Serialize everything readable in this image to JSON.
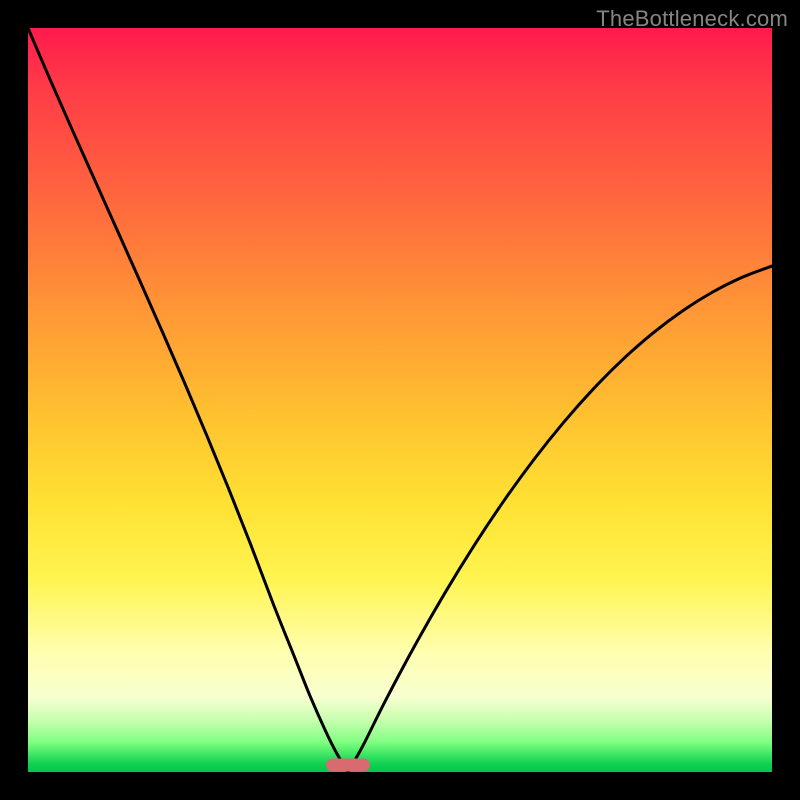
{
  "watermark": "TheBottleneck.com",
  "chart_data": {
    "type": "line",
    "title": "",
    "xlabel": "",
    "ylabel": "",
    "xlim": [
      0,
      100
    ],
    "ylim": [
      0,
      100
    ],
    "gradient_stops": [
      {
        "t": 0,
        "color": "#ff1a4d"
      },
      {
        "t": 8,
        "color": "#ff3b47"
      },
      {
        "t": 24,
        "color": "#ff6a3d"
      },
      {
        "t": 38,
        "color": "#ff9736"
      },
      {
        "t": 52,
        "color": "#ffc130"
      },
      {
        "t": 64,
        "color": "#ffe233"
      },
      {
        "t": 74,
        "color": "#fff450"
      },
      {
        "t": 84,
        "color": "#ffffb0"
      },
      {
        "t": 90,
        "color": "#f7ffd0"
      },
      {
        "t": 93,
        "color": "#c8ffb0"
      },
      {
        "t": 96,
        "color": "#80ff80"
      },
      {
        "t": 98,
        "color": "#30e060"
      },
      {
        "t": 99,
        "color": "#0ecf50"
      },
      {
        "t": 100,
        "color": "#00c84b"
      }
    ],
    "series": [
      {
        "name": "left-branch",
        "x": [
          0.0,
          3.0,
          6.0,
          9.0,
          12.0,
          15.0,
          18.0,
          21.0,
          24.0,
          27.0,
          30.0,
          33.0,
          36.0,
          38.0,
          40.0,
          41.5,
          43.0
        ],
        "y": [
          100.0,
          93.0,
          86.2,
          79.5,
          72.8,
          66.1,
          59.3,
          52.4,
          45.3,
          38.0,
          30.4,
          22.5,
          15.0,
          10.0,
          5.5,
          2.5,
          0.0
        ]
      },
      {
        "name": "right-branch",
        "x": [
          43.0,
          45.0,
          48.0,
          52.0,
          56.0,
          60.0,
          64.0,
          68.0,
          72.0,
          76.0,
          80.0,
          84.0,
          88.0,
          92.0,
          96.0,
          100.0
        ],
        "y": [
          0.0,
          3.5,
          9.5,
          17.0,
          24.0,
          30.5,
          36.5,
          42.0,
          47.0,
          51.5,
          55.5,
          59.0,
          62.0,
          64.5,
          66.5,
          68.0
        ]
      }
    ],
    "marker": {
      "x": 43.0,
      "y": 1.0,
      "color": "#d96b70",
      "shape": "pill"
    }
  }
}
